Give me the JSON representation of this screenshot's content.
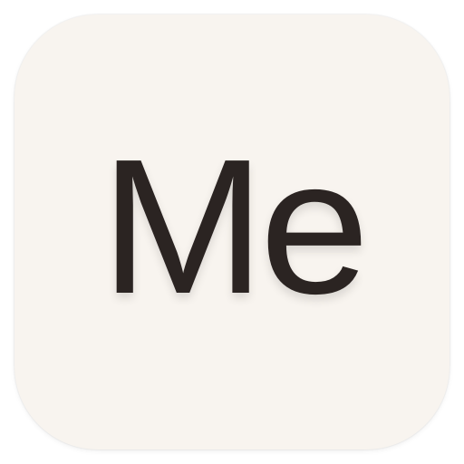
{
  "app_icon": {
    "logo_text": "Me",
    "background_color": "#f8f4ef",
    "text_color": "#2b2422"
  }
}
